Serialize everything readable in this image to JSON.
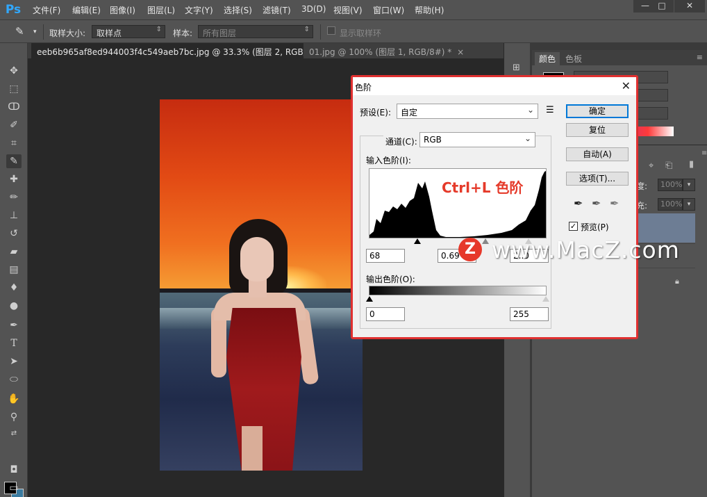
{
  "app": {
    "logo": "Ps",
    "accent": "#31a8ff"
  },
  "menu": {
    "items": [
      "文件(F)",
      "编辑(E)",
      "图像(I)",
      "图层(L)",
      "文字(Y)",
      "选择(S)",
      "滤镜(T)",
      "3D(D)",
      "视图(V)",
      "窗口(W)",
      "帮助(H)"
    ]
  },
  "window_controls": {
    "minimize": "—",
    "maximize": "□",
    "close": "✕"
  },
  "options_bar": {
    "tool_icon": "eyedropper-icon",
    "sample_size_label": "取样大小:",
    "sample_size_value": "取样点",
    "sample_label": "样本:",
    "sample_value": "所有图层",
    "show_ring_label": "显示取样环"
  },
  "tabs": [
    {
      "label": "eeb6b965af8ed944003f4c549aeb7bc.jpg @ 33.3% (图层 2, RGB/8) *",
      "close": "×"
    },
    {
      "label": "01.jpg @ 100% (图层 1, RGB/8#) *",
      "close": "×"
    }
  ],
  "toolbar": {
    "tools": [
      "move-icon",
      "marquee-icon",
      "lasso-icon",
      "quick-select-icon",
      "crop-icon",
      "eyedropper-icon",
      "healing-icon",
      "brush-icon",
      "stamp-icon",
      "history-brush-icon",
      "eraser-icon",
      "gradient-icon",
      "blur-icon",
      "dodge-icon",
      "pen-icon",
      "type-icon",
      "path-select-icon",
      "ellipse-icon",
      "hand-icon",
      "zoom-icon"
    ],
    "type_glyph": "T",
    "fg_color": "#000000",
    "bg_color": "#3a7ba0"
  },
  "right_panels": {
    "color_tab": "颜色",
    "swatches_tab": "色板",
    "opacity_label": "度:",
    "opacity_value": "100%",
    "fill_label": "充:",
    "fill_value": "100%"
  },
  "dialog": {
    "title": "色阶",
    "close": "✕",
    "preset_label": "预设(E):",
    "preset_value": "自定",
    "channel_label": "通道(C):",
    "channel_value": "RGB",
    "input_levels_label": "输入色阶(I):",
    "input_black": "68",
    "input_gamma": "0.69",
    "input_white": "2..0",
    "output_levels_label": "输出色阶(O):",
    "output_black": "0",
    "output_white": "255",
    "buttons": {
      "ok": "确定",
      "reset": "复位",
      "auto": "自动(A)",
      "options": "选项(T)..."
    },
    "preview_label": "预览(P)",
    "preview_checked": "✓",
    "annotation": "Ctrl+L 色阶",
    "annotation_color": "#e53a2a",
    "highlight_border": "#e03030"
  },
  "watermark": {
    "logo_letter": "Z",
    "text": "www.MacZ.com"
  }
}
